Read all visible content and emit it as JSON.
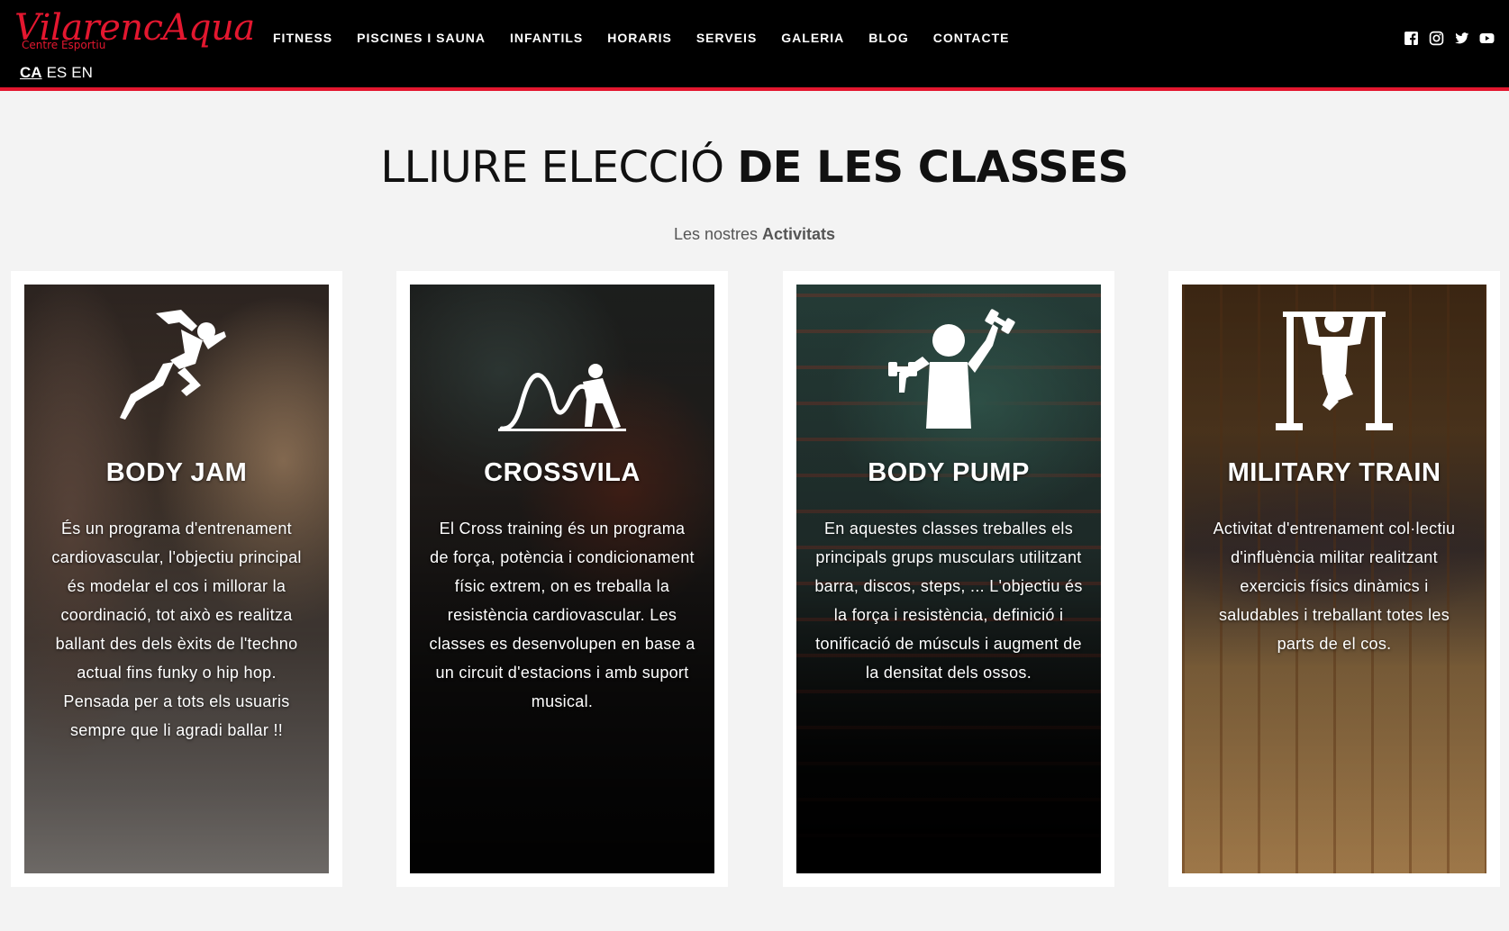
{
  "header": {
    "logo": {
      "name": "VilarencAqua",
      "tagline": "Centre Esportiu"
    },
    "languages": [
      {
        "code": "CA",
        "active": true
      },
      {
        "code": "ES",
        "active": false
      },
      {
        "code": "EN",
        "active": false
      }
    ],
    "nav": [
      "FITNESS",
      "PISCINES I SAUNA",
      "INFANTILS",
      "HORARIS",
      "SERVEIS",
      "GALERIA",
      "BLOG",
      "CONTACTE"
    ],
    "social": [
      "facebook-icon",
      "instagram-icon",
      "twitter-icon",
      "youtube-icon"
    ]
  },
  "section": {
    "title_light": "LLIURE ELECCIÓ ",
    "title_bold": "DE LES CLASSES",
    "subtitle_prefix": "Les nostres ",
    "subtitle_bold": "Activitats"
  },
  "cards": [
    {
      "title": "BODY JAM",
      "icon": "sprinter-icon",
      "text": "És un programa d'entrenament cardiovascular, l'objectiu principal és modelar el cos i millorar la coordinació, tot això es realitza ballant des dels èxits de l'techno actual fins funky o hip hop. Pensada per a tots els usuaris sempre que li agradi ballar !!"
    },
    {
      "title": "CROSSVILA",
      "icon": "battle-ropes-icon",
      "text": "El Cross training és un programa de força, potència i condicionament físic extrem, on es treballa la resistència cardiovascular. Les classes es desenvolupen en base a un circuit d'estacions i amb suport musical."
    },
    {
      "title": "BODY PUMP",
      "icon": "dumbbell-lifter-icon",
      "text": "En aquestes classes treballes els principals grups musculars utilitzant barra, discos, steps, ... L'objectiu és la força i resistència, definició i tonificació de músculs i augment de la densitat dels ossos."
    },
    {
      "title": "MILITARY TRAIN",
      "icon": "pull-up-bar-icon",
      "text": "Activitat d'entrenament col·lectiu d'influència militar realitzant exercicis físics dinàmics i saludables i treballant totes les parts de el cos."
    }
  ],
  "colors": {
    "accent": "#e3172f",
    "header_bg": "#000000",
    "page_bg": "#f3f3f3"
  }
}
